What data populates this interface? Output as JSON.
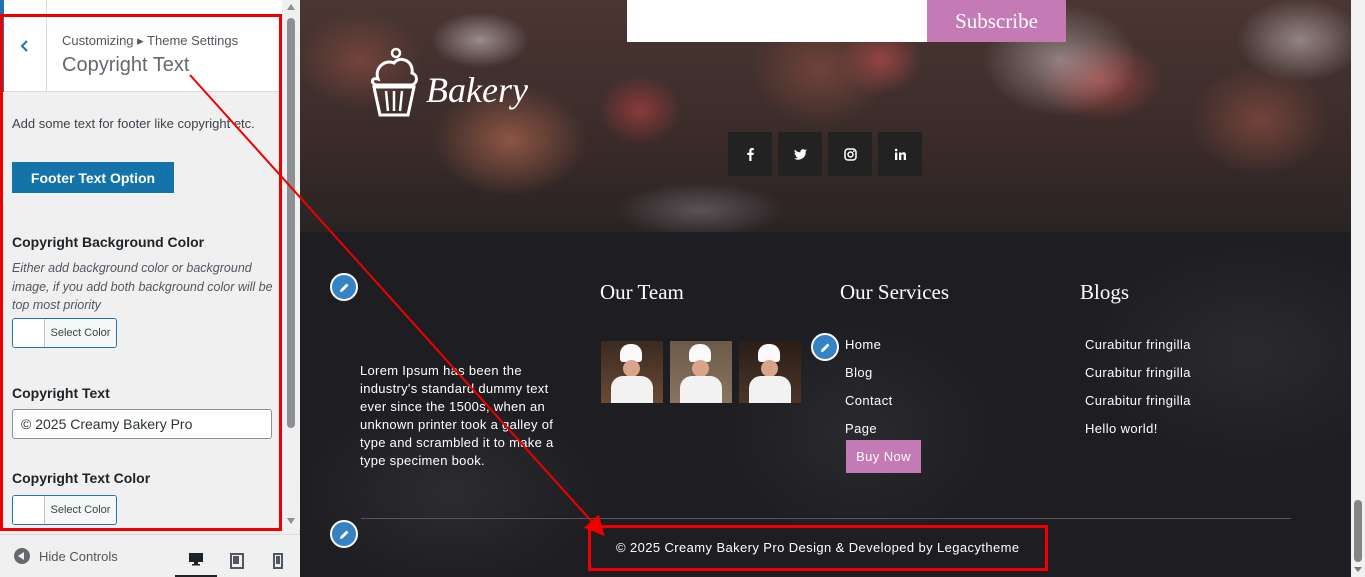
{
  "customizer": {
    "breadcrumb": "Customizing ▸ Theme Settings",
    "section_title": "Copyright Text",
    "description": "Add some text for footer like copyright etc.",
    "footer_text_option_label": "Footer Text Option",
    "copyright_bg_label": "Copyright Background Color",
    "copyright_bg_desc": "Either add background color or background image, if you add both background color will be top most priority",
    "select_color_label": "Select Color",
    "copyright_text_label": "Copyright Text",
    "copyright_text_value": "© 2025 Creamy Bakery Pro",
    "copyright_text_color_label": "Copyright Text Color",
    "hide_controls_label": "Hide Controls",
    "accent_color": "#2271b1"
  },
  "preview": {
    "subscribe_label": "Subscribe",
    "social_icons": [
      "facebook-icon",
      "twitter-icon",
      "instagram-icon",
      "linkedin-icon"
    ],
    "logo_text": "Bakery",
    "about_text": "Lorem Ipsum has been the industry's standard dummy text ever since the 1500s, when an unknown printer took a galley of type and scrambled it to make a type specimen book.",
    "team_heading": "Our Team",
    "services_heading": "Our Services",
    "services_links": [
      "Home",
      "Blog",
      "Contact",
      "Page"
    ],
    "buy_now_label": "Buy Now",
    "blogs_heading": "Blogs",
    "blog_links": [
      "Curabitur fringilla",
      "Curabitur fringilla",
      "Curabitur fringilla",
      "Hello world!"
    ],
    "copyright": "© 2025 Creamy Bakery Pro Design & Developed by Legacytheme",
    "button_color": "#c47ab5"
  },
  "annotation": {
    "highlight_color": "#ee0000"
  }
}
